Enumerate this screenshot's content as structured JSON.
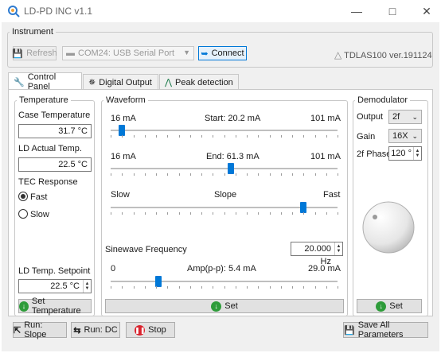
{
  "window": {
    "title": "LD-PD INC v1.1"
  },
  "instrument": {
    "legend": "Instrument",
    "refresh_label": "Refresh",
    "port_value": "COM24: USB Serial Port",
    "connect_label": "Connect",
    "device_label": "TDLAS100 ver.191124"
  },
  "tabs": [
    {
      "label": "Control Panel"
    },
    {
      "label": "Digital Output"
    },
    {
      "label": "Peak detection"
    }
  ],
  "temperature": {
    "legend": "Temperature",
    "case_label": "Case Temperature",
    "case_value": "31.7 °C",
    "ld_actual_label": "LD Actual Temp.",
    "ld_actual_value": "22.5 °C",
    "tec_label": "TEC Response",
    "fast_label": "Fast",
    "slow_label": "Slow",
    "setpoint_label": "LD Temp. Setpoint",
    "setpoint_value": "22.5 °C",
    "set_button": "Set Temperature",
    "tec_selected": "Fast"
  },
  "waveform": {
    "legend": "Waveform",
    "start_min": "16 mA",
    "start_text": "Start:  20.2 mA",
    "start_max": "101 mA",
    "start_fraction": 0.05,
    "end_min": "16 mA",
    "end_text": "End:  61.3 mA",
    "end_max": "101 mA",
    "end_fraction": 0.53,
    "slope_min": "Slow",
    "slope_text": "Slope",
    "slope_max": "Fast",
    "slope_fraction": 0.85,
    "sine_label": "Sinewave Frequency",
    "sine_value": "20.000 Hz",
    "amp_min": "0",
    "amp_text": "Amp(p-p):  5.4 mA",
    "amp_max": "29.0 mA",
    "amp_fraction": 0.21,
    "set_button": "Set"
  },
  "demodulator": {
    "legend": "Demodulator",
    "output_label": "Output",
    "output_value": "2f",
    "gain_label": "Gain",
    "gain_value": "16X",
    "phase_label": "2f Phase",
    "phase_value": "120 °",
    "set_button": "Set"
  },
  "bottom": {
    "run_slope": "Run: Slope",
    "run_dc": "Run: DC",
    "stop": "Stop",
    "save_all": "Save All Parameters"
  },
  "colors": {
    "accent": "#0078d7",
    "green": "#2e9c3a",
    "stop_red": "#d9232d"
  }
}
